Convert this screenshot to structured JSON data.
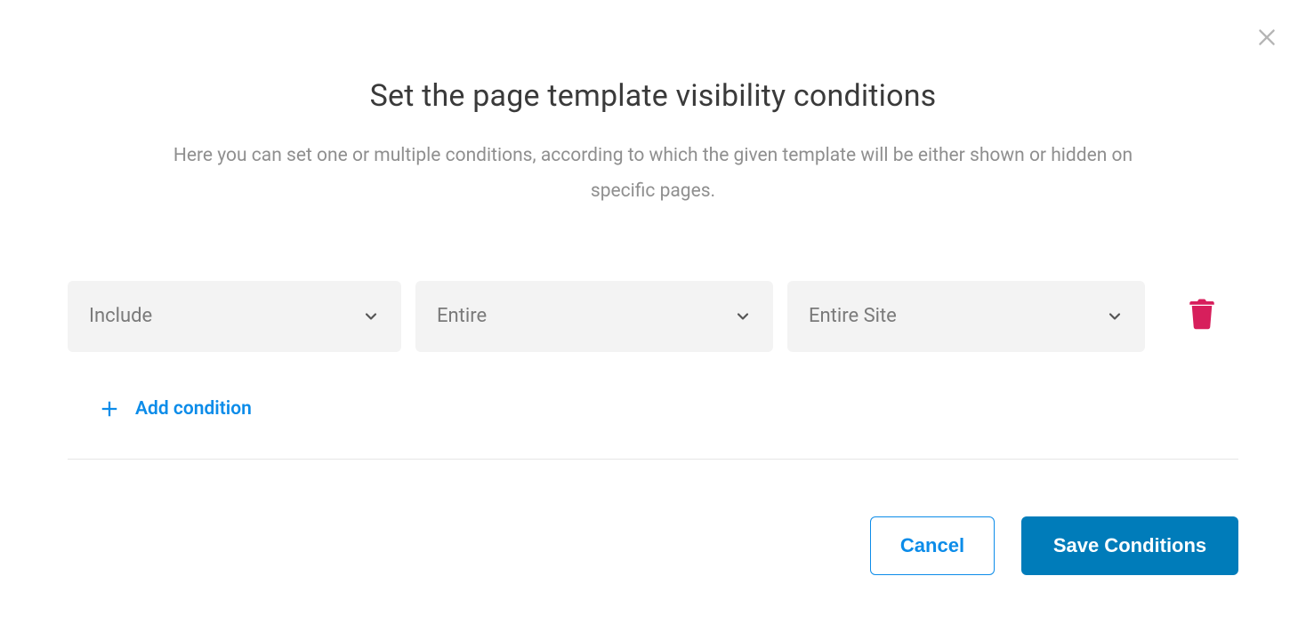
{
  "dialog": {
    "title": "Set the page template visibility conditions",
    "subtitle": "Here you can set one or multiple conditions, according to which the given template will be either shown or hidden on specific pages."
  },
  "conditions": [
    {
      "mode": "Include",
      "scope": "Entire",
      "target": "Entire Site"
    }
  ],
  "actions": {
    "add_condition": "Add condition",
    "cancel": "Cancel",
    "save": "Save Conditions"
  }
}
